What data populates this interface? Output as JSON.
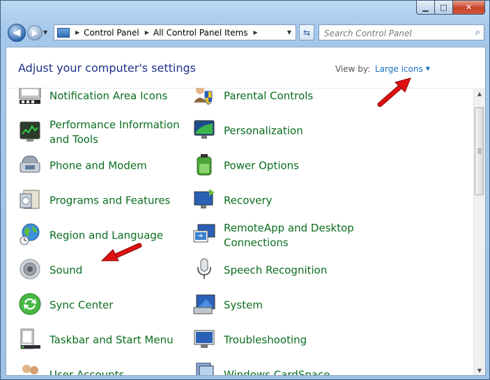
{
  "window": {
    "caption_buttons": {
      "minimize": "▁",
      "maximize": "□",
      "close": "✕"
    }
  },
  "nav": {
    "back_icon": "back-arrow-icon",
    "forward_icon": "forward-arrow-icon",
    "breadcrumb": [
      "Control Panel",
      "All Control Panel Items"
    ],
    "search_placeholder": "Search Control Panel"
  },
  "header": {
    "title": "Adjust your computer's settings",
    "view_by_label": "View by:",
    "view_by_value": "Large icons"
  },
  "items": {
    "left": [
      {
        "label": "Notification Area Icons",
        "icon": "notification-area-icon"
      },
      {
        "label": "Performance Information and Tools",
        "icon": "performance-icon"
      },
      {
        "label": "Phone and Modem",
        "icon": "phone-modem-icon"
      },
      {
        "label": "Programs and Features",
        "icon": "programs-icon"
      },
      {
        "label": "Region and Language",
        "icon": "globe-icon"
      },
      {
        "label": "Sound",
        "icon": "speaker-icon"
      },
      {
        "label": "Sync Center",
        "icon": "sync-icon"
      },
      {
        "label": "Taskbar and Start Menu",
        "icon": "taskbar-icon"
      },
      {
        "label": "User Accounts",
        "icon": "users-icon"
      }
    ],
    "right": [
      {
        "label": "Parental Controls",
        "icon": "parental-controls-icon"
      },
      {
        "label": "Personalization",
        "icon": "personalization-icon"
      },
      {
        "label": "Power Options",
        "icon": "battery-icon"
      },
      {
        "label": "Recovery",
        "icon": "recovery-icon"
      },
      {
        "label": "RemoteApp and Desktop Connections",
        "icon": "remote-desktop-icon"
      },
      {
        "label": "Speech Recognition",
        "icon": "microphone-icon"
      },
      {
        "label": "System",
        "icon": "system-icon"
      },
      {
        "label": "Troubleshooting",
        "icon": "troubleshooting-icon"
      },
      {
        "label": "Windows CardSpace",
        "icon": "cardspace-icon"
      }
    ]
  },
  "colors": {
    "link_green": "#0a6e1f",
    "title_blue": "#1e3287",
    "annotation_red": "#e01010"
  }
}
